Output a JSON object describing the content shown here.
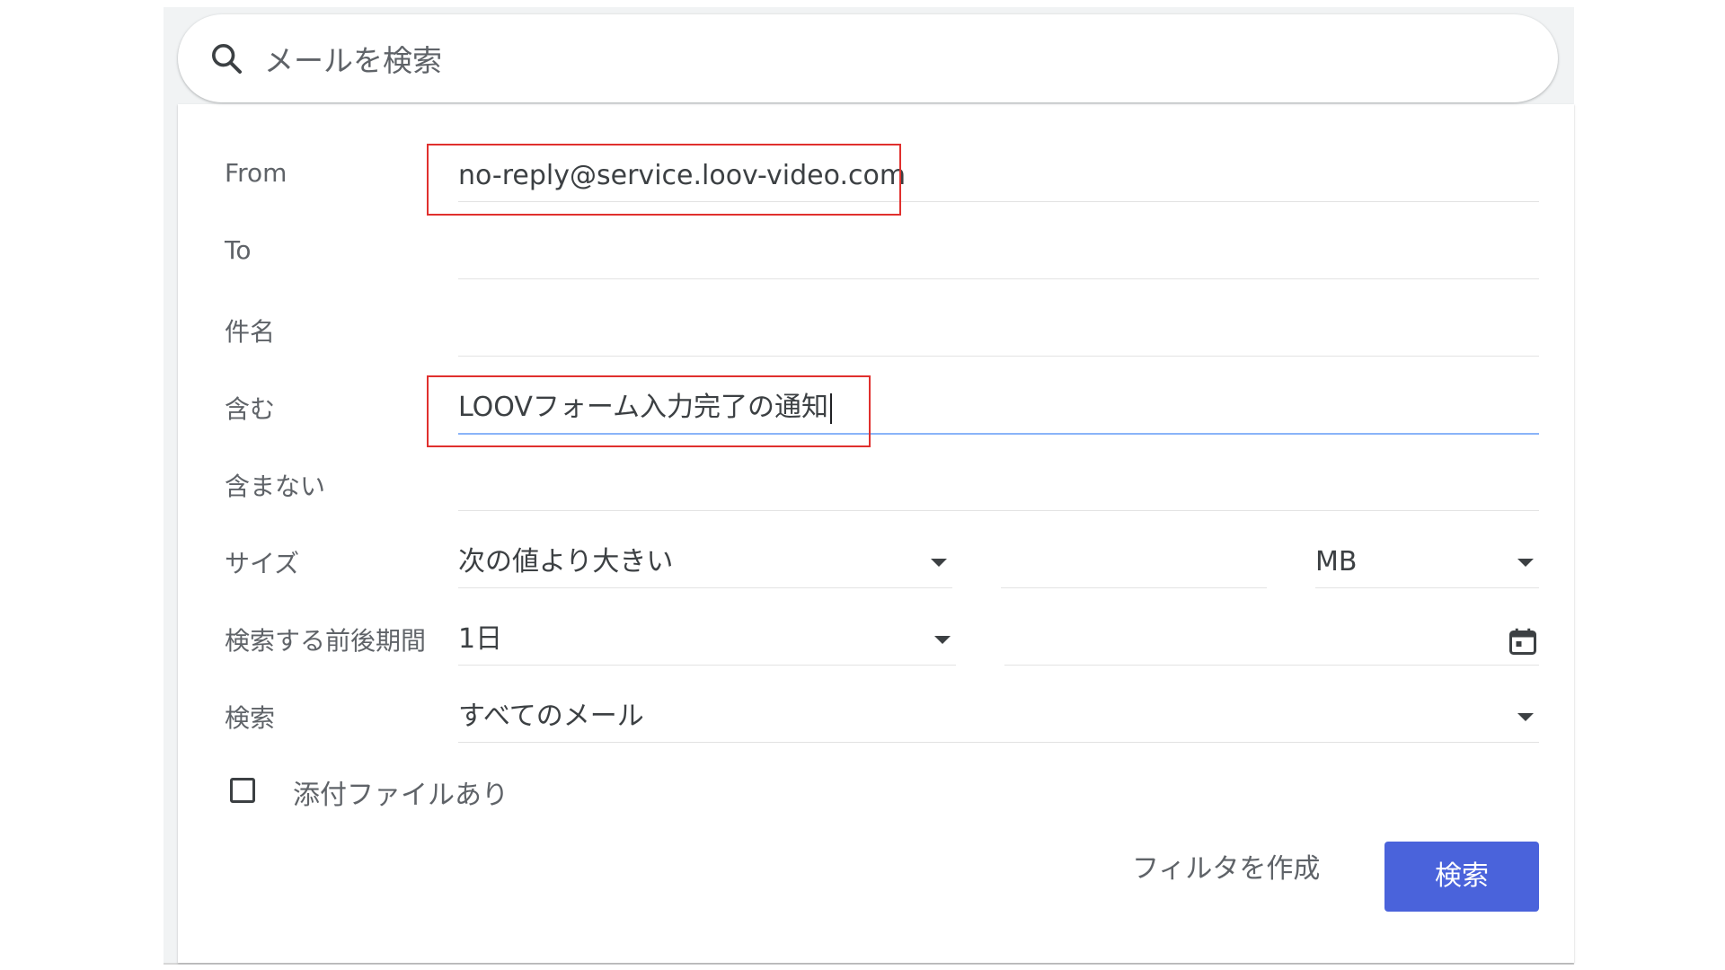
{
  "search": {
    "placeholder": "メールを検索",
    "icon": "search-icon"
  },
  "form": {
    "from": {
      "label": "From",
      "value": "no-reply@service.loov-video.com"
    },
    "to": {
      "label": "To",
      "value": ""
    },
    "subject": {
      "label": "件名",
      "value": ""
    },
    "has_words": {
      "label": "含む",
      "value": "LOOVフォーム入力完了の通知"
    },
    "doesnt_have": {
      "label": "含まない",
      "value": ""
    },
    "size": {
      "label": "サイズ",
      "operator": "次の値より大きい",
      "value": "",
      "unit": "MB"
    },
    "date_within": {
      "label": "検索する前後期間",
      "range": "1日",
      "date": "",
      "icon": "calendar-icon"
    },
    "search_in": {
      "label": "検索",
      "value": "すべてのメール"
    },
    "has_attachment": {
      "label": "添付ファイルあり",
      "checked": false
    }
  },
  "actions": {
    "create_filter": "フィルタを作成",
    "search": "検索"
  },
  "colors": {
    "primary_button": "#4a63db",
    "highlight_border": "#e0302e",
    "focus_underline": "#8ab4f8"
  }
}
